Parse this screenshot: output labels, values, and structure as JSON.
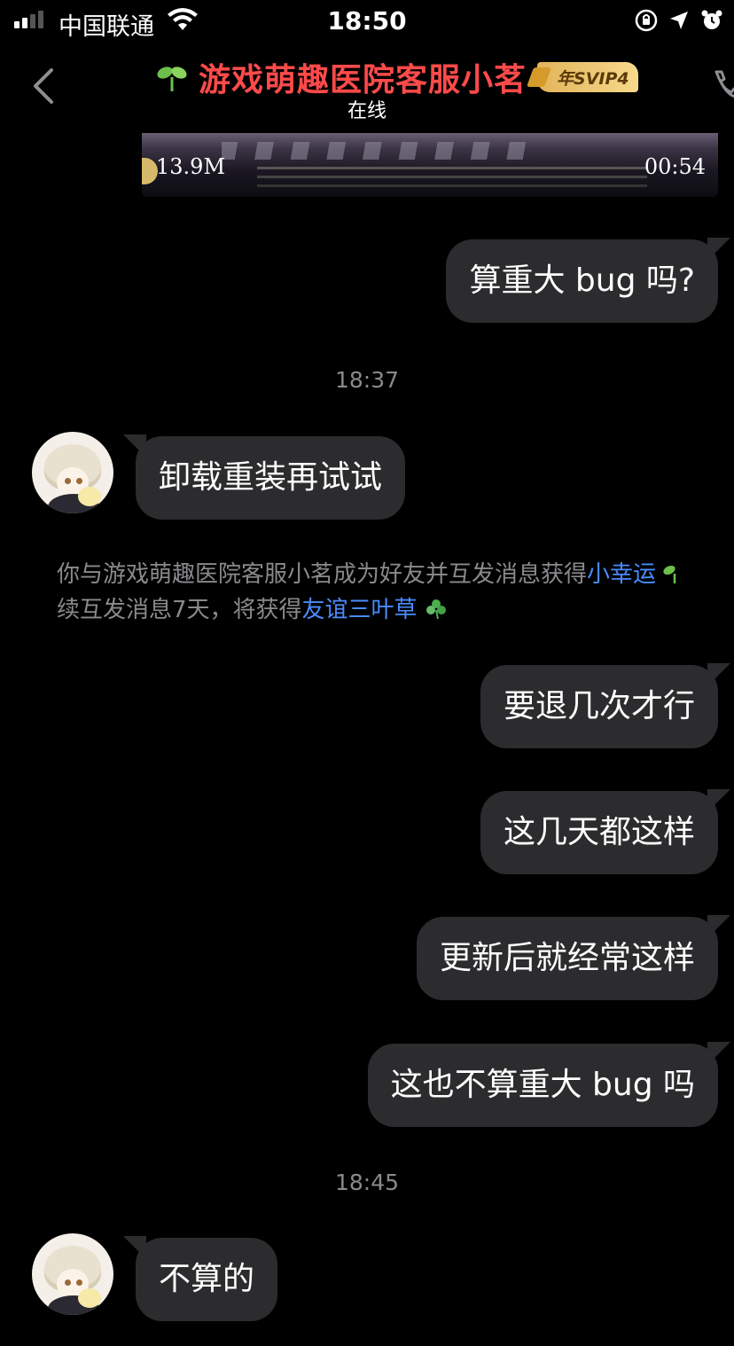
{
  "status_bar": {
    "carrier": "中国联通",
    "time": "18:50"
  },
  "header": {
    "title": "游戏萌趣医院客服小茗",
    "badge": "年SVIP4",
    "subtitle": "在线"
  },
  "video": {
    "size": "13.9M",
    "duration": "00:54"
  },
  "messages": [
    {
      "side": "right",
      "text": "算重大 bug 吗?"
    },
    {
      "time": "18:37"
    },
    {
      "side": "left",
      "text": "卸载重装再试试"
    },
    {
      "side": "right",
      "text": "要退几次才行"
    },
    {
      "side": "right",
      "text": "这几天都这样"
    },
    {
      "side": "right",
      "text": "更新后就经常这样"
    },
    {
      "side": "right",
      "text": "这也不算重大 bug 吗"
    },
    {
      "time": "18:45"
    },
    {
      "side": "left",
      "text": "不算的"
    }
  ],
  "system_message": {
    "line1_prefix": "你与游戏萌趣医院客服小茗成为好友并互发消息获得",
    "line1_link": "小幸运",
    "line2_prefix": "续互发消息7天，将获得",
    "line2_link": "友谊三叶草"
  }
}
